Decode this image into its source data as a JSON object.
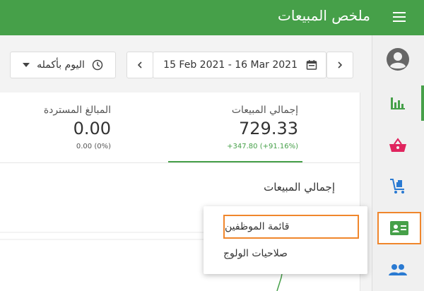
{
  "header": {
    "title": "ملخص المبيعات",
    "menu_icon": "hamburger-menu-icon"
  },
  "colors": {
    "brand": "#46a049",
    "highlight": "#f0862c",
    "positive": "#46a049",
    "basket": "#e0245e",
    "cart": "#2a7ad2",
    "card_icon": "#46a049",
    "people": "#2a7ad2"
  },
  "toolbar": {
    "date_range": "15 Feb 2021 - 16 Mar 2021",
    "all_day_label": "اليوم بأكمله"
  },
  "sidebar": {
    "items": [
      {
        "icon": "account-circle-icon"
      },
      {
        "icon": "bar-chart-icon",
        "active": true
      },
      {
        "icon": "basket-icon"
      },
      {
        "icon": "cart-icon"
      },
      {
        "icon": "id-card-icon",
        "highlighted": true
      },
      {
        "icon": "people-icon"
      }
    ]
  },
  "metrics": {
    "total_sales": {
      "label": "إجمالي المبيعات",
      "value": "729.33",
      "delta": "+347.80 (+91.16%)"
    },
    "refunds": {
      "label": "المبالغ المستردة",
      "value": "0.00",
      "delta": "0.00 (0%)"
    }
  },
  "section": {
    "title": "إجمالي المبيعات"
  },
  "dropdown": {
    "items": [
      {
        "label": "قائمة الموظفين",
        "highlighted": true
      },
      {
        "label": "صلاحيات الولوج"
      }
    ]
  }
}
